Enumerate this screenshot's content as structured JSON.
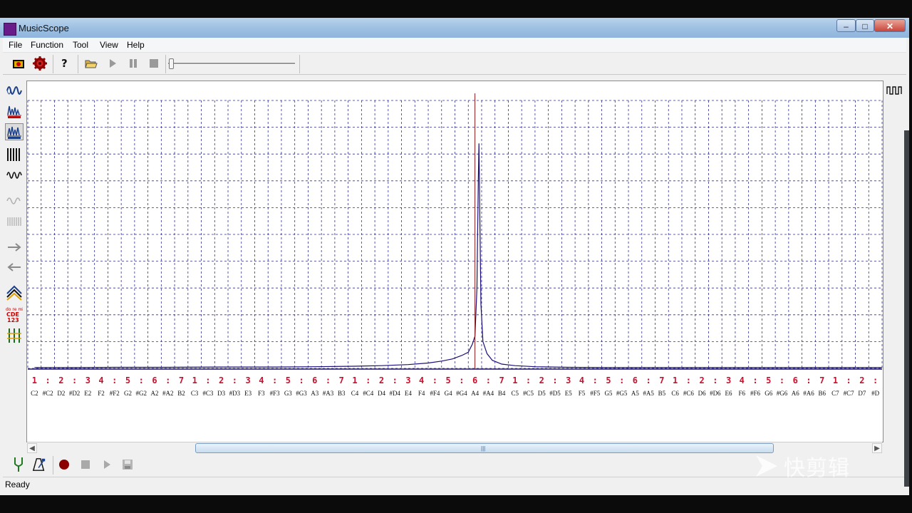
{
  "window": {
    "title": "MusicScope"
  },
  "menu": [
    "File",
    "Function",
    "Tool",
    "View",
    "Help"
  ],
  "toolbar_icons": [
    "camera-icon",
    "gear-icon",
    "help-icon",
    "open-folder-icon",
    "play-icon",
    "pause-icon",
    "stop-icon"
  ],
  "left_tool_icons": [
    "waveform-icon",
    "spectrum-icon",
    "spectrum-notes-icon",
    "pulse-icon",
    "wave-small-icon",
    "wave-disabled-icon",
    "pulse-disabled-icon",
    "arrow-right-icon",
    "arrow-left-icon",
    "peaks-icon",
    "notation-icon",
    "bars-icon"
  ],
  "bottom_tool_icons": [
    "tuning-fork-icon",
    "metronome-icon",
    "record-icon",
    "stop-icon",
    "play-icon",
    "save-icon"
  ],
  "scale_markers": [
    "1",
    ":",
    "2",
    ":",
    "3",
    "4",
    ":",
    "5",
    ":",
    "6",
    ":",
    "7",
    "1",
    ":",
    "2",
    ":",
    "3",
    "4",
    ":",
    "5",
    ":",
    "6",
    ":",
    "7",
    "1",
    ":",
    "2",
    ":",
    "3",
    "4",
    ":",
    "5",
    ":",
    "6",
    ":",
    "7",
    "1",
    ":",
    "2",
    ":",
    "3",
    "4",
    ":",
    "5",
    ":",
    "6",
    ":",
    "7",
    "1",
    ":",
    "2",
    ":",
    "3",
    "4",
    ":",
    "5",
    ":",
    "6",
    ":",
    "7",
    "1",
    ":",
    "2",
    ":"
  ],
  "note_labels": [
    "C2",
    "#C2",
    "D2",
    "#D2",
    "E2",
    "F2",
    "#F2",
    "G2",
    "#G2",
    "A2",
    "#A2",
    "B2",
    "C3",
    "#C3",
    "D3",
    "#D3",
    "E3",
    "F3",
    "#F3",
    "G3",
    "#G3",
    "A3",
    "#A3",
    "B3",
    "C4",
    "#C4",
    "D4",
    "#D4",
    "E4",
    "F4",
    "#F4",
    "G4",
    "#G4",
    "A4",
    "#A4",
    "B4",
    "C5",
    "#C5",
    "D5",
    "#D5",
    "E5",
    "F5",
    "#F5",
    "G5",
    "#G5",
    "A5",
    "#A5",
    "B5",
    "C6",
    "#C6",
    "D6",
    "#D6",
    "E6",
    "F6",
    "#F6",
    "G6",
    "#G6",
    "A6",
    "#A6",
    "B6",
    "C7",
    "#C7",
    "D7",
    "#D"
  ],
  "chart_data": {
    "type": "line",
    "title": "",
    "xlabel": "",
    "ylabel": "",
    "x_unit": "note",
    "peak_note": "A4",
    "cursor_note": "A4",
    "grid": true,
    "spectrum": [
      {
        "x": 0,
        "y": 0.003
      },
      {
        "x": 3,
        "y": 0.003
      },
      {
        "x": 6,
        "y": 0.004
      },
      {
        "x": 10,
        "y": 0.004
      },
      {
        "x": 14,
        "y": 0.005
      },
      {
        "x": 18,
        "y": 0.005
      },
      {
        "x": 21,
        "y": 0.006
      },
      {
        "x": 24,
        "y": 0.008
      },
      {
        "x": 26,
        "y": 0.01
      },
      {
        "x": 28,
        "y": 0.014
      },
      {
        "x": 29.5,
        "y": 0.02
      },
      {
        "x": 30.5,
        "y": 0.027
      },
      {
        "x": 31.3,
        "y": 0.035
      },
      {
        "x": 32,
        "y": 0.048
      },
      {
        "x": 32.5,
        "y": 0.06
      },
      {
        "x": 32.8,
        "y": 0.09
      },
      {
        "x": 33.0,
        "y": 0.12
      },
      {
        "x": 33.15,
        "y": 0.3
      },
      {
        "x": 33.25,
        "y": 0.7
      },
      {
        "x": 33.3,
        "y": 0.84
      },
      {
        "x": 33.35,
        "y": 0.62
      },
      {
        "x": 33.45,
        "y": 0.24
      },
      {
        "x": 33.6,
        "y": 0.1
      },
      {
        "x": 33.9,
        "y": 0.055
      },
      {
        "x": 34.3,
        "y": 0.03
      },
      {
        "x": 35,
        "y": 0.016
      },
      {
        "x": 36,
        "y": 0.01
      },
      {
        "x": 37.5,
        "y": 0.006
      },
      {
        "x": 40,
        "y": 0.004
      },
      {
        "x": 43,
        "y": 0.003
      },
      {
        "x": 63.5,
        "y": 0.003
      }
    ]
  },
  "status": "Ready",
  "watermark": "快剪辑"
}
